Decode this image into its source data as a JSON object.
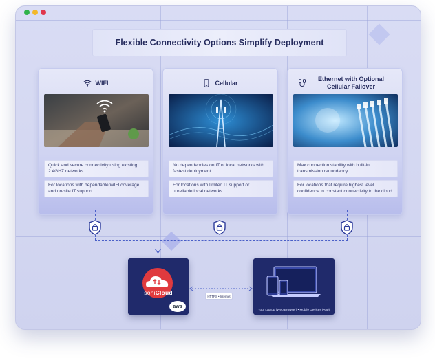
{
  "title": "Flexible Connectivity Options Simplify Deployment",
  "cards": [
    {
      "heading": "WIFI",
      "icon": "wifi-icon",
      "points": [
        "Quick and secure connectivity using existing 2.4GHZ networks",
        "For locations with dependable WIFI coverage and on-site IT support"
      ]
    },
    {
      "heading": "Cellular",
      "icon": "phone-icon",
      "points": [
        "No dependencies on IT or local networks with fastest deployment",
        "For locations with limited IT support or unreliable local networks"
      ]
    },
    {
      "heading": "Ethernet with Optional Cellular Failover",
      "icon": "ethernet-icon",
      "points": [
        "Max connection stability with built-in transmission redundancy",
        "For locations that require highest level confidence in constant connectivity to the cloud"
      ]
    }
  ],
  "cloud": {
    "brand_left": "soni",
    "brand_right": "Cloud",
    "aws": "aws"
  },
  "link_label": "HTTPS • Internet",
  "devices_caption": "Your Laptop (Web Browser) • Mobile Devices (App)",
  "colors": {
    "accent": "#4a5fc8",
    "dark_box": "#202a6b",
    "sonicloud_red": "#e03a3e"
  }
}
